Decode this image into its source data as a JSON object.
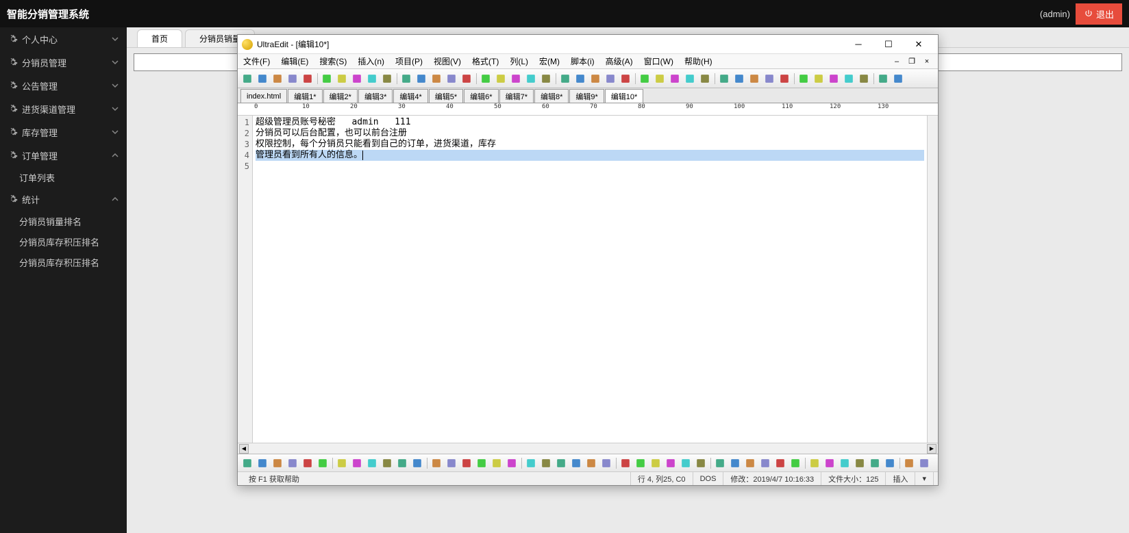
{
  "topbar": {
    "title": "智能分销管理系统",
    "user": "(admin)",
    "logout": "退出"
  },
  "sidebar": {
    "groups": [
      {
        "label": "个人中心",
        "open": false
      },
      {
        "label": "分销员管理",
        "open": false
      },
      {
        "label": "公告管理",
        "open": false
      },
      {
        "label": "进货渠道管理",
        "open": false
      },
      {
        "label": "库存管理",
        "open": false
      },
      {
        "label": "订单管理",
        "open": true,
        "children": [
          "订单列表"
        ]
      },
      {
        "label": "统计",
        "open": true,
        "children": [
          "分销员销量排名",
          "分销员库存积压排名",
          "分销员库存积压排名"
        ]
      }
    ]
  },
  "main": {
    "tabs": [
      {
        "label": "首页",
        "active": true
      },
      {
        "label": "分销员销量",
        "active": false
      }
    ],
    "input_value": ""
  },
  "ultraedit": {
    "title": "UltraEdit - [编辑10*]",
    "menus": [
      "文件(F)",
      "编辑(E)",
      "搜索(S)",
      "插入(n)",
      "项目(P)",
      "视图(V)",
      "格式(T)",
      "列(L)",
      "宏(M)",
      "脚本(i)",
      "高级(A)",
      "窗口(W)",
      "帮助(H)"
    ],
    "doc_tabs": [
      "index.html",
      "编辑1*",
      "编辑2*",
      "编辑3*",
      "编辑4*",
      "编辑5*",
      "编辑6*",
      "编辑7*",
      "编辑8*",
      "编辑9*",
      "编辑10*"
    ],
    "active_doc": 10,
    "ruler_marks": [
      0,
      10,
      20,
      30,
      40,
      50,
      60,
      70,
      80,
      90,
      100,
      110,
      120,
      130
    ],
    "lines": [
      "超级管理员账号秘密   admin   111",
      "分销员可以后台配置，也可以前台注册",
      "权限控制，每个分销员只能看到自己的订单，进货渠道，库存",
      "管理员看到所有人的信息。"
    ],
    "highlight_line": 4,
    "status": {
      "help": "按 F1 获取帮助",
      "pos": "行 4, 列25, C0",
      "encoding": "DOS",
      "modified": "修改：2019/4/7 10:16:33",
      "size": "文件大小：125",
      "mode": "插入"
    }
  }
}
